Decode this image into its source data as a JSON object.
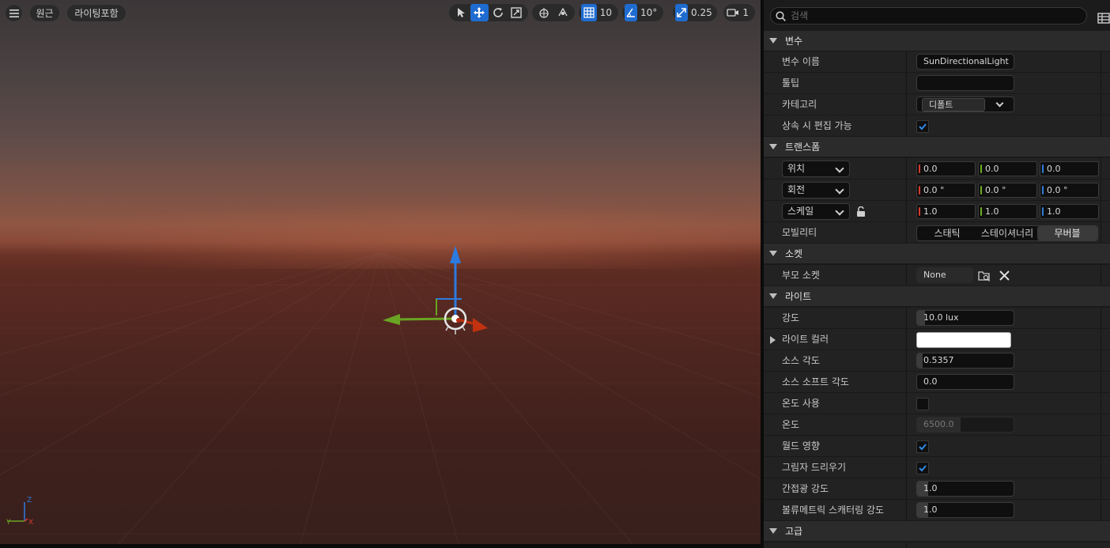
{
  "viewport": {
    "view_mode": "원근",
    "lighting_mode": "라이팅포함",
    "grid_snap": "10",
    "rotation_snap": "10°",
    "scale_snap": "0.25",
    "camera_speed": "1",
    "axis_labels": {
      "z": "Z",
      "x": "X",
      "y": "Y"
    }
  },
  "details": {
    "search_placeholder": "검색",
    "sections": {
      "variable": "변수",
      "transform": "트랜스폼",
      "socket": "소켓",
      "light": "라이트",
      "advanced": "고급"
    },
    "variable": {
      "name_label": "변수 이름",
      "name_value": "SunDirectionalLight",
      "tooltip_label": "툴팁",
      "tooltip_value": "",
      "category_label": "카테고리",
      "category_value": "디폴트",
      "editable_label": "상속 시 편집 가능",
      "editable_checked": true
    },
    "transform": {
      "location_label": "위치",
      "location": [
        "0.0",
        "0.0",
        "0.0"
      ],
      "rotation_label": "회전",
      "rotation": [
        "0.0 °",
        "0.0 °",
        "0.0 °"
      ],
      "scale_label": "스케일",
      "scale": [
        "1.0",
        "1.0",
        "1.0"
      ],
      "mobility_label": "모빌리티",
      "mobility_options": [
        "스태틱",
        "스테이셔너리",
        "무버블"
      ],
      "mobility_selected": "무버블"
    },
    "socket": {
      "parent_label": "부모 소켓",
      "parent_value": "None"
    },
    "light": {
      "intensity_label": "강도",
      "intensity_value": "10.0 lux",
      "color_label": "라이트 컬러",
      "color_value": "#ffffff",
      "source_angle_label": "소스 각도",
      "source_angle_value": "0.5357",
      "source_soft_angle_label": "소스 소프트 각도",
      "source_soft_angle_value": "0.0",
      "use_temperature_label": "온도 사용",
      "use_temperature_checked": false,
      "temperature_label": "온도",
      "temperature_value": "6500.0",
      "affects_world_label": "월드 영향",
      "affects_world_checked": true,
      "cast_shadows_label": "그림자 드리우기",
      "cast_shadows_checked": true,
      "indirect_label": "간접광 강도",
      "indirect_value": "1.0",
      "volumetric_label": "볼류메트릭 스캐터링 강도",
      "volumetric_value": "1.0"
    }
  }
}
